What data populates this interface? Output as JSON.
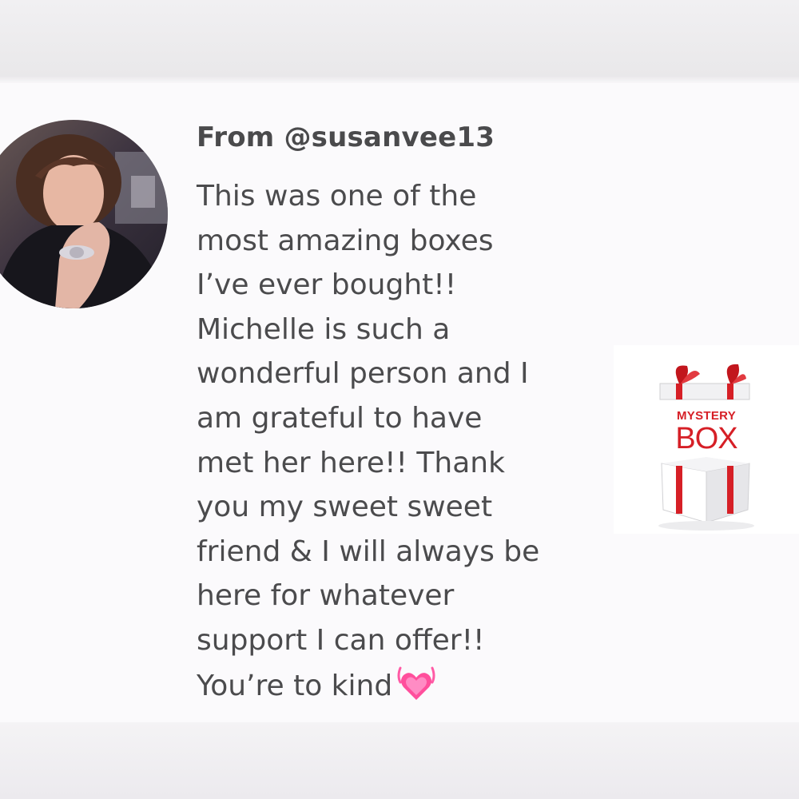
{
  "post": {
    "from_label": "From @susanvee13",
    "comment_lines": [
      "This was one of the",
      "most amazing boxes",
      "I’ve ever bought!!",
      "Michelle is such a",
      "wonderful person and I",
      "am grateful to have",
      "met her here!! Thank",
      "you my sweet sweet",
      "friend & I will always be",
      "here for whatever",
      "support I can offer!!",
      "You’re to kind"
    ],
    "emoji": "growing-heart"
  },
  "mystery_box": {
    "line1": "MYSTERY",
    "line2": "BOX"
  },
  "colors": {
    "text": "#4b4b4d",
    "accent_red": "#d61f26",
    "heart_pink": "#ff4f9c"
  }
}
